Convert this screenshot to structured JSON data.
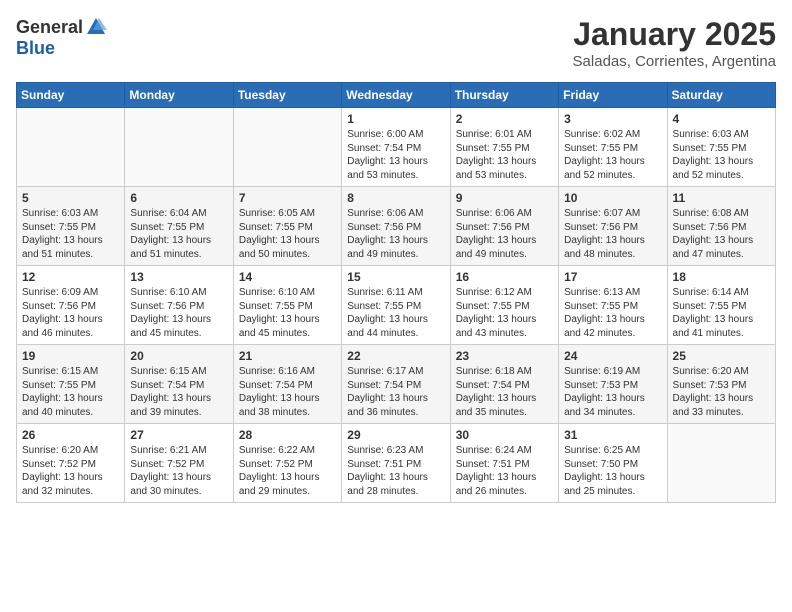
{
  "header": {
    "logo_general": "General",
    "logo_blue": "Blue",
    "month_title": "January 2025",
    "location": "Saladas, Corrientes, Argentina"
  },
  "days_of_week": [
    "Sunday",
    "Monday",
    "Tuesday",
    "Wednesday",
    "Thursday",
    "Friday",
    "Saturday"
  ],
  "weeks": [
    [
      {
        "day": "",
        "info": ""
      },
      {
        "day": "",
        "info": ""
      },
      {
        "day": "",
        "info": ""
      },
      {
        "day": "1",
        "info": "Sunrise: 6:00 AM\nSunset: 7:54 PM\nDaylight: 13 hours\nand 53 minutes."
      },
      {
        "day": "2",
        "info": "Sunrise: 6:01 AM\nSunset: 7:55 PM\nDaylight: 13 hours\nand 53 minutes."
      },
      {
        "day": "3",
        "info": "Sunrise: 6:02 AM\nSunset: 7:55 PM\nDaylight: 13 hours\nand 52 minutes."
      },
      {
        "day": "4",
        "info": "Sunrise: 6:03 AM\nSunset: 7:55 PM\nDaylight: 13 hours\nand 52 minutes."
      }
    ],
    [
      {
        "day": "5",
        "info": "Sunrise: 6:03 AM\nSunset: 7:55 PM\nDaylight: 13 hours\nand 51 minutes."
      },
      {
        "day": "6",
        "info": "Sunrise: 6:04 AM\nSunset: 7:55 PM\nDaylight: 13 hours\nand 51 minutes."
      },
      {
        "day": "7",
        "info": "Sunrise: 6:05 AM\nSunset: 7:55 PM\nDaylight: 13 hours\nand 50 minutes."
      },
      {
        "day": "8",
        "info": "Sunrise: 6:06 AM\nSunset: 7:56 PM\nDaylight: 13 hours\nand 49 minutes."
      },
      {
        "day": "9",
        "info": "Sunrise: 6:06 AM\nSunset: 7:56 PM\nDaylight: 13 hours\nand 49 minutes."
      },
      {
        "day": "10",
        "info": "Sunrise: 6:07 AM\nSunset: 7:56 PM\nDaylight: 13 hours\nand 48 minutes."
      },
      {
        "day": "11",
        "info": "Sunrise: 6:08 AM\nSunset: 7:56 PM\nDaylight: 13 hours\nand 47 minutes."
      }
    ],
    [
      {
        "day": "12",
        "info": "Sunrise: 6:09 AM\nSunset: 7:56 PM\nDaylight: 13 hours\nand 46 minutes."
      },
      {
        "day": "13",
        "info": "Sunrise: 6:10 AM\nSunset: 7:56 PM\nDaylight: 13 hours\nand 45 minutes."
      },
      {
        "day": "14",
        "info": "Sunrise: 6:10 AM\nSunset: 7:55 PM\nDaylight: 13 hours\nand 45 minutes."
      },
      {
        "day": "15",
        "info": "Sunrise: 6:11 AM\nSunset: 7:55 PM\nDaylight: 13 hours\nand 44 minutes."
      },
      {
        "day": "16",
        "info": "Sunrise: 6:12 AM\nSunset: 7:55 PM\nDaylight: 13 hours\nand 43 minutes."
      },
      {
        "day": "17",
        "info": "Sunrise: 6:13 AM\nSunset: 7:55 PM\nDaylight: 13 hours\nand 42 minutes."
      },
      {
        "day": "18",
        "info": "Sunrise: 6:14 AM\nSunset: 7:55 PM\nDaylight: 13 hours\nand 41 minutes."
      }
    ],
    [
      {
        "day": "19",
        "info": "Sunrise: 6:15 AM\nSunset: 7:55 PM\nDaylight: 13 hours\nand 40 minutes."
      },
      {
        "day": "20",
        "info": "Sunrise: 6:15 AM\nSunset: 7:54 PM\nDaylight: 13 hours\nand 39 minutes."
      },
      {
        "day": "21",
        "info": "Sunrise: 6:16 AM\nSunset: 7:54 PM\nDaylight: 13 hours\nand 38 minutes."
      },
      {
        "day": "22",
        "info": "Sunrise: 6:17 AM\nSunset: 7:54 PM\nDaylight: 13 hours\nand 36 minutes."
      },
      {
        "day": "23",
        "info": "Sunrise: 6:18 AM\nSunset: 7:54 PM\nDaylight: 13 hours\nand 35 minutes."
      },
      {
        "day": "24",
        "info": "Sunrise: 6:19 AM\nSunset: 7:53 PM\nDaylight: 13 hours\nand 34 minutes."
      },
      {
        "day": "25",
        "info": "Sunrise: 6:20 AM\nSunset: 7:53 PM\nDaylight: 13 hours\nand 33 minutes."
      }
    ],
    [
      {
        "day": "26",
        "info": "Sunrise: 6:20 AM\nSunset: 7:52 PM\nDaylight: 13 hours\nand 32 minutes."
      },
      {
        "day": "27",
        "info": "Sunrise: 6:21 AM\nSunset: 7:52 PM\nDaylight: 13 hours\nand 30 minutes."
      },
      {
        "day": "28",
        "info": "Sunrise: 6:22 AM\nSunset: 7:52 PM\nDaylight: 13 hours\nand 29 minutes."
      },
      {
        "day": "29",
        "info": "Sunrise: 6:23 AM\nSunset: 7:51 PM\nDaylight: 13 hours\nand 28 minutes."
      },
      {
        "day": "30",
        "info": "Sunrise: 6:24 AM\nSunset: 7:51 PM\nDaylight: 13 hours\nand 26 minutes."
      },
      {
        "day": "31",
        "info": "Sunrise: 6:25 AM\nSunset: 7:50 PM\nDaylight: 13 hours\nand 25 minutes."
      },
      {
        "day": "",
        "info": ""
      }
    ]
  ]
}
